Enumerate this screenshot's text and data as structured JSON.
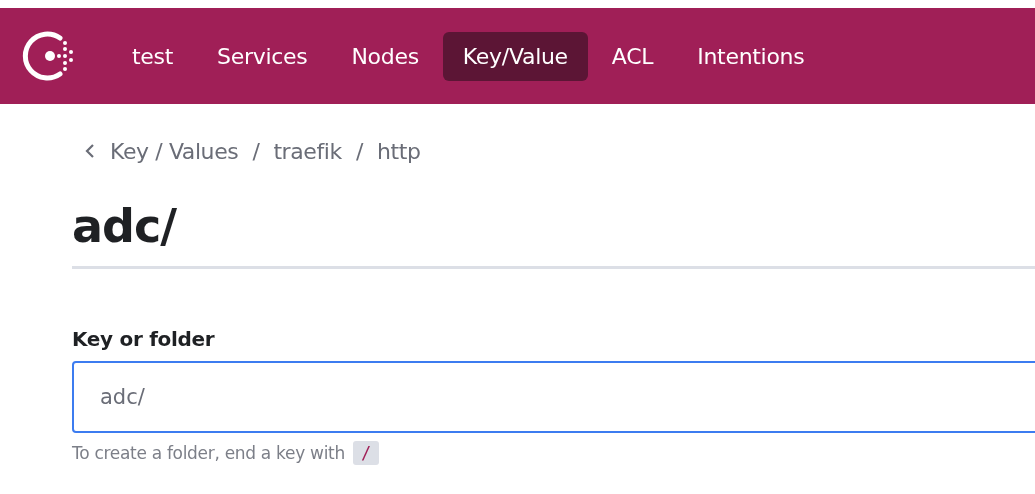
{
  "nav": {
    "tabs": [
      {
        "label": "test",
        "selected": false
      },
      {
        "label": "Services",
        "selected": false
      },
      {
        "label": "Nodes",
        "selected": false
      },
      {
        "label": "Key/Value",
        "selected": true
      },
      {
        "label": "ACL",
        "selected": false
      },
      {
        "label": "Intentions",
        "selected": false
      }
    ]
  },
  "breadcrumbs": [
    {
      "label": "Key / Values"
    },
    {
      "separator": "/",
      "label": "traefik"
    },
    {
      "separator": "/",
      "label": "http"
    }
  ],
  "title": "adc/",
  "form": {
    "label": "Key or folder",
    "value": "adc/",
    "help": "To create a folder, end a key with",
    "help_code": "/"
  }
}
